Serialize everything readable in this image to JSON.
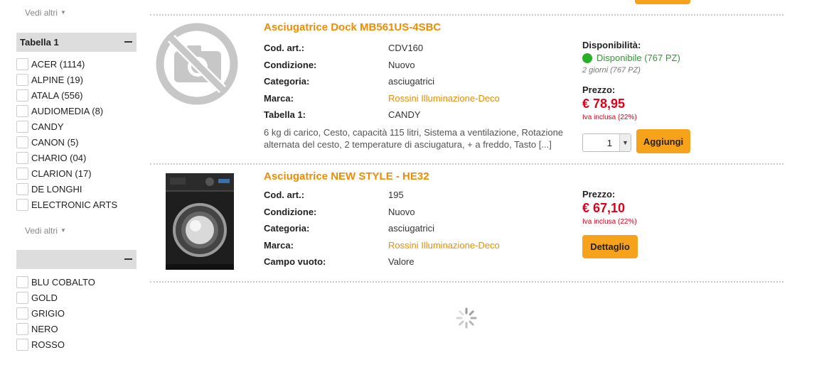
{
  "sidebar": {
    "see_more_label": "Vedi altri",
    "filter1": {
      "title": "Tabella 1",
      "items": [
        "ACER (1114)",
        "ALPINE (19)",
        "ATALA (556)",
        "AUDIOMEDIA (8)",
        "CANDY",
        "CANON (5)",
        "CHARIO (04)",
        "CLARION (17)",
        "DE LONGHI",
        "ELECTRONIC ARTS"
      ]
    },
    "filter2": {
      "title": "",
      "items": [
        "BLU COBALTO",
        "GOLD",
        "GRIGIO",
        "NERO",
        "ROSSO"
      ]
    }
  },
  "products": [
    {
      "title": "Asciugatrice Dock MB561US-4SBC",
      "image": "no-photo-icon",
      "specs": [
        {
          "label": "Cod. art.:",
          "value": "CDV160"
        },
        {
          "label": "Condizione:",
          "value": "Nuovo"
        },
        {
          "label": "Categoria:",
          "value": "asciugatrici"
        },
        {
          "label": "Marca:",
          "value": "Rossini Illuminazione-Deco"
        },
        {
          "label": "Tabella 1:",
          "value": "CANDY"
        }
      ],
      "description": "6 kg di carico, Cesto, capacità 115 litri, Sistema a ventilazione, Rotazione alternata del cesto, 2 temperature di asciugatura, + a freddo, Tasto [...]",
      "availability_label": "Disponibilità:",
      "availability_status": "Disponibile (767 PZ)",
      "delivery": "2 giorni (767 PZ)",
      "price_label": "Prezzo:",
      "price": "€ 78,95",
      "vat": "Iva inclusa (22%)",
      "quantity": "1",
      "button": "Aggiungi"
    },
    {
      "title": "Asciugatrice NEW STYLE - HE32",
      "image": "washing-machine-photo",
      "specs": [
        {
          "label": "Cod. art.:",
          "value": "195"
        },
        {
          "label": "Condizione:",
          "value": "Nuovo"
        },
        {
          "label": "Categoria:",
          "value": "asciugatrici"
        },
        {
          "label": "Marca:",
          "value": "Rossini Illuminazione-Deco"
        },
        {
          "label": "Campo vuoto:",
          "value": "Valore"
        }
      ],
      "price_label": "Prezzo:",
      "price": "€ 67,10",
      "vat": "Iva inclusa (22%)",
      "button": "Dettaglio"
    }
  ],
  "colors": {
    "accent": "#f7a21b",
    "title": "#f08c00",
    "price": "#e0001a",
    "available": "#27b027"
  }
}
